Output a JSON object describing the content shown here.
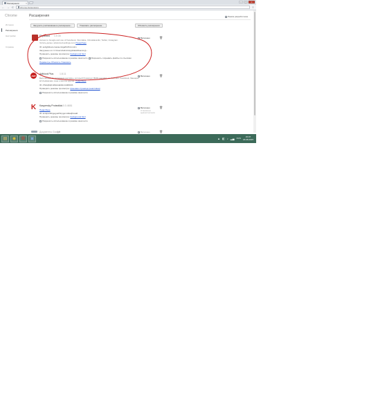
{
  "browser": {
    "tab_title": "Расширения",
    "address": "chrome://extensions",
    "tab_close": "×",
    "win_controls": [
      "–",
      "▢",
      "×"
    ],
    "nav": {
      "back": "←",
      "forward": "→",
      "reload": "C",
      "menu": "≡"
    }
  },
  "sidebar": {
    "title": "Chrome",
    "items": [
      {
        "label": "История",
        "active": false
      },
      {
        "label": "Расширения",
        "active": true
      },
      {
        "label": "Настройки",
        "active": false
      },
      {
        "label": "Справка",
        "active": false
      }
    ]
  },
  "page": {
    "title": "Расширения",
    "dev_mode_label": "Режим разработчика",
    "dev_mode_checked": true,
    "buttons": {
      "load_unpacked": "Загрузить распакованное расширение...",
      "pack": "Упаковать расширение...",
      "update": "Обновить расширения"
    }
  },
  "extensions": [
    {
      "name": "FlipBoard",
      "version": "1.0.34",
      "logo_color": "#b7312a",
      "logo_glyph": "",
      "desc_lines": [
        "Access to Google and use of Facebook, Vkontakte, Odnoklassniki, Twitter, Instagram.",
        "Читать далее: advanced-settings.com"
      ],
      "desc_link": "Подробнее",
      "id": "ID: aobgbkkocemacaemkgafbcfbmmolm",
      "loaded_from": "Загружено из: C:\\Users\\Admin\\AppData\\Roaming\\...",
      "inspect_label": "Проверить режимы просмотра:",
      "inspect_link": "background.html",
      "allow_incognito": "Разрешить использование в режиме инкогнито",
      "allow_files": "Разрешить открывать файлы по ссылкам",
      "extra_link": "Параметры   Обновить   Упаковать",
      "enabled_label": "Включено",
      "enabled": true,
      "circled": true
    },
    {
      "name": "Adblock Plus",
      "version": "1.8.11",
      "logo_color": "#c8201e",
      "logo_glyph": "ABP",
      "desc_lines": [
        "Бесплатный блокировщик рекламы, который блокирует ВСЮ рекламу на YouTube, Facebook, баннеры,",
        "всплывающие окна и многое другое."
      ],
      "desc_link": "Подробнее",
      "id": "ID: cfhdojbkjhnklbpkdaibdccddilifddb",
      "inspect_label": "Проверить режимы просмотра:",
      "inspect_link": "фоновая страница (неактивна)",
      "allow_incognito": "Разрешить использование в режиме инкогнито",
      "enabled_label": "Включено",
      "enabled": true,
      "circled": false
    },
    {
      "name": "Kaspersky Protection",
      "version": "14.0.0.4651",
      "logo_color": "#c8201e",
      "logo_glyph": "K",
      "desc_lines": [
        "Подробнее"
      ],
      "id": "ID: amkpcclbbgegoafihnpgomddadjhcadd",
      "inspect_label": "Проверить режимы просмотра:",
      "inspect_link": "background.html",
      "allow_incognito": "Разрешить использование в режиме инкогнито",
      "enabled_label": "Включено",
      "enabled": true,
      "installed_note": "Установлено администратором",
      "circled": false
    },
    {
      "name": "Документы Google",
      "version": "0.9",
      "logo_color": "#9aa7b5",
      "logo_glyph": "",
      "enabled_label": "Включено",
      "enabled": true,
      "circled": false
    }
  ],
  "taskbar": {
    "apps": [
      {
        "name": "file-explorer-icon",
        "glyph": "▤",
        "color": "#e8c16a"
      },
      {
        "name": "chrome-icon",
        "glyph": "◉",
        "color": "#e2c23a"
      },
      {
        "name": "opera-icon",
        "glyph": "O",
        "color": "#d83a2e"
      },
      {
        "name": "monitor-icon",
        "glyph": "▣",
        "color": "#7fa9d8"
      }
    ],
    "tray_icons": [
      "▲",
      "◧",
      "♪",
      "▂▄"
    ],
    "lang": "RUS",
    "time": "15:07",
    "date": "18.08.2015"
  },
  "annotation": {
    "color": "#cc1f1f"
  }
}
